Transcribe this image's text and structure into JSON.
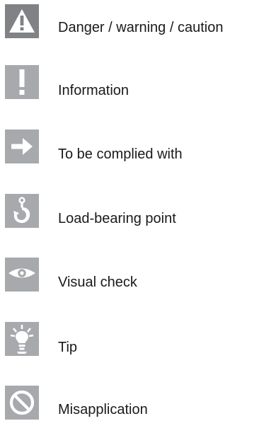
{
  "legend": {
    "items": [
      {
        "icon": "warning-triangle-icon",
        "label": "Danger / warning / caution"
      },
      {
        "icon": "exclamation-icon",
        "label": "Information"
      },
      {
        "icon": "arrow-right-icon",
        "label": "To be complied with"
      },
      {
        "icon": "lifting-hook-icon",
        "label": "Load-bearing point"
      },
      {
        "icon": "eye-icon",
        "label": "Visual check"
      },
      {
        "icon": "light-bulb-icon",
        "label": "Tip"
      },
      {
        "icon": "prohibition-icon",
        "label": "Misapplication"
      }
    ]
  },
  "colors": {
    "icon_background": "#a7a9ac",
    "icon_background_dark": "#808285",
    "icon_glyph": "#ffffff",
    "text": "#1a1a1a"
  }
}
